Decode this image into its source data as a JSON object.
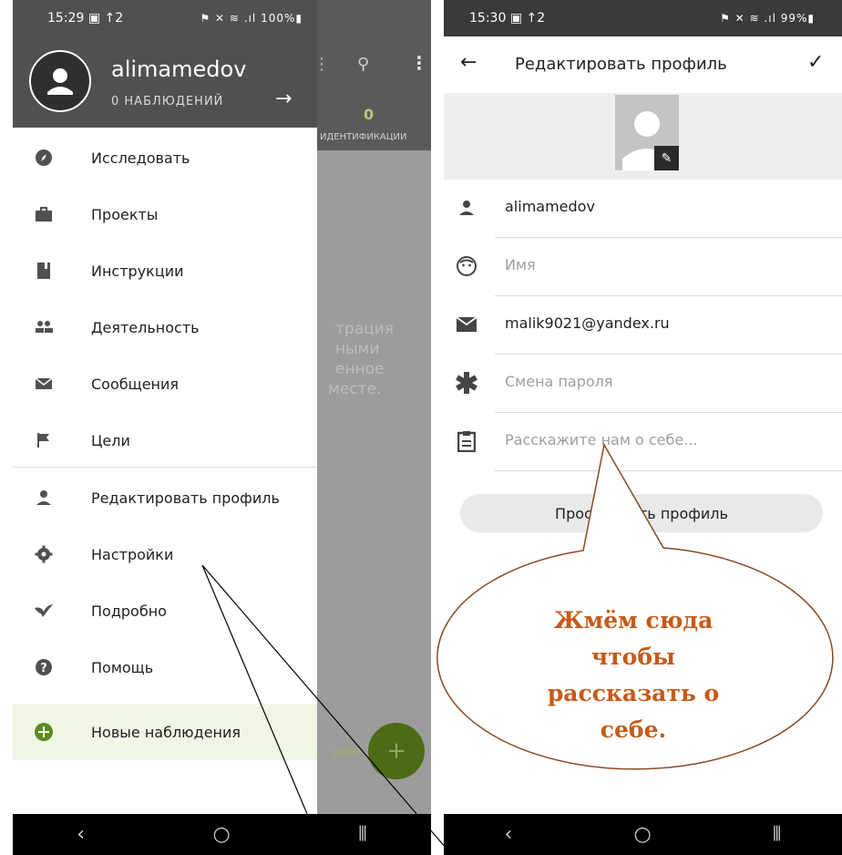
{
  "left_phone": {
    "status_time": "15:29",
    "status_left_icons": "▣ ↑2",
    "status_right": "⚑ ✕ ≋ .ıl 100%▮",
    "background_label_count": "0",
    "background_label_text": "ИДЕНТИФИКАЦИИ",
    "background_text_lines": [
      "трация",
      "ными",
      "енное",
      "месте."
    ],
    "background_text_bottom": "ние",
    "drawer": {
      "username": "alimamedov",
      "observations": "0 НАБЛЮДЕНИЙ",
      "items": [
        {
          "label": "Исследовать",
          "icon": "compass-icon"
        },
        {
          "label": "Проекты",
          "icon": "briefcase-icon"
        },
        {
          "label": "Инструкции",
          "icon": "book-icon"
        },
        {
          "label": "Деятельность",
          "icon": "people-icon"
        },
        {
          "label": "Сообщения",
          "icon": "mail-icon"
        },
        {
          "label": "Цели",
          "icon": "flag-icon"
        },
        {
          "label": "Редактировать профиль",
          "icon": "person-icon"
        },
        {
          "label": "Настройки",
          "icon": "gear-icon"
        },
        {
          "label": "Подробно",
          "icon": "bird-icon"
        },
        {
          "label": "Помощь",
          "icon": "help-icon"
        },
        {
          "label": "Новые наблюдения",
          "icon": "plus-circle-icon"
        }
      ]
    }
  },
  "right_phone": {
    "status_time": "15:30",
    "status_left_icons": "▣ ↑2",
    "status_right": "⚑ ✕ ≋ .ıl 99%▮",
    "title": "Редактировать профиль",
    "fields": [
      {
        "value": "alimamedov",
        "placeholder": false,
        "icon": "person-icon"
      },
      {
        "value": "Имя",
        "placeholder": true,
        "icon": "face-icon"
      },
      {
        "value": "malik9021@yandex.ru",
        "placeholder": false,
        "icon": "email-icon"
      },
      {
        "value": "Смена пароля",
        "placeholder": true,
        "icon": "asterisk-icon"
      },
      {
        "value": "Расскажите нам о себе...",
        "placeholder": true,
        "icon": "clipboard-icon"
      }
    ],
    "view_profile_button": "Просмотреть профиль"
  },
  "callout": {
    "lines": [
      "Жмём сюда",
      "чтобы",
      "рассказать о",
      "себе."
    ],
    "color": "#c65a18"
  }
}
